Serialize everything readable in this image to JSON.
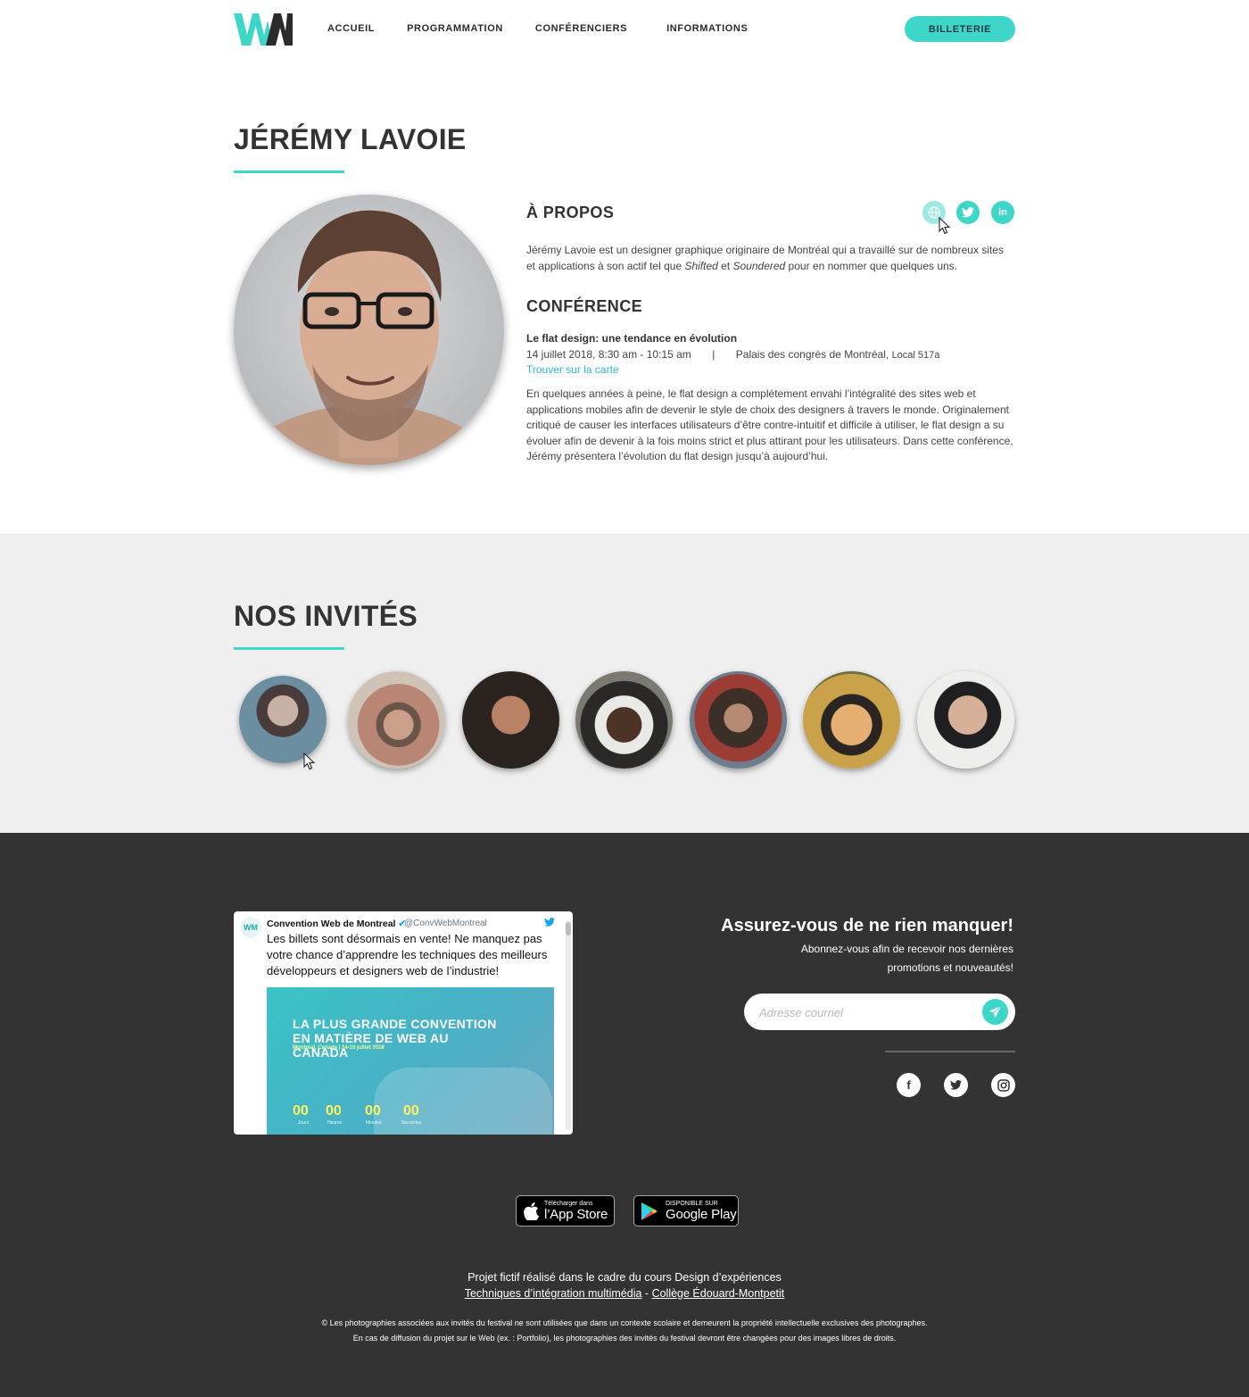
{
  "colors": {
    "accent": "#3dd6c9",
    "link": "#2ab7d4",
    "footer_bg": "#333333",
    "band_bg": "#efefef"
  },
  "header": {
    "logo_text": "WM",
    "nav": [
      "ACCUEIL",
      "PROGRAMMATION",
      "CONFÉRENCIERS",
      "INFORMATIONS"
    ],
    "ticket_label": "BILLETERIE"
  },
  "speaker": {
    "name": "JÉRÉMY LAVOIE",
    "about_heading": "À PROPOS",
    "social_icons": [
      "globe-icon",
      "twitter-icon",
      "linkedin-icon"
    ],
    "about_pre": "Jérémy Lavoie est un designer graphique originaire de Montréal qui a travaillé sur de nombreux sites et applications à son actif tel que ",
    "about_em1": "Shifted",
    "about_mid": " et ",
    "about_em2": "Soundered",
    "about_post": " pour en nommer que quelques uns.",
    "conference_heading": "CONFÉRENCE",
    "conference_title": "Le flat design: une tendance en évolution",
    "conference_datetime": "14 juillet 2018, 8:30 am - 10:15 am",
    "conference_separator": "|",
    "conference_venue": "Palais des congrès de Montréal,",
    "conference_room": "Local 517a",
    "map_link": "Trouver sur la carte",
    "conference_description": "En quelques années à peine, le flat design a complètement envahi l’intégralité des sites web et applications mobiles afin de devenir le style de choix des designers à travers le monde. Originalement critiqué de causer les interfaces utilisateurs d’être contre-intuitif et difficile à utiliser, le flat design a su évoluer afin de devenir à la fois moins strict et plus attirant pour les utilisateurs. Dans cette conférence, Jérémy présentera l’évolution du flat design jusqu’à aujourd’hui."
  },
  "guests": {
    "title": "NOS INVITÉS",
    "count": 7
  },
  "footer": {
    "tweet": {
      "account": "Convention Web de Montreal",
      "handle": "@ConvWebMontreal",
      "text": "Les billets sont désormais en vente! Ne manquez pas votre chance d’apprendre les techniques des meilleurs développeurs et designers web de l’industrie!",
      "media_headline": "LA PLUS GRANDE CONVENTION EN MATIÈRE DE WEB AU CANADA",
      "media_sub": "Montréal, Canada | 14-16 juillet 2018",
      "countdown": [
        {
          "value": "00",
          "label": "Jours"
        },
        {
          "value": "00",
          "label": "Heures"
        },
        {
          "value": "00",
          "label": "Minutes"
        },
        {
          "value": "00",
          "label": "Secondes"
        }
      ]
    },
    "newsletter_title": "Assurez-vous de ne rien manquer!",
    "newsletter_text": "Abonnez-vous afin de recevoir nos dernières promotions et nouveautés!",
    "email_placeholder": "Adresse courriel",
    "social_icons": [
      "facebook-icon",
      "twitter-icon",
      "instagram-icon"
    ],
    "app_store_small": "Télécharger dans",
    "app_store_big": "l’App Store",
    "google_play_small": "DISPONIBLE SUR",
    "google_play_big": "Google Play",
    "credit_line": "Projet fictif réalisé dans le cadre du cours Design d’expériences",
    "credit_link1": "Techniques d’intégration multimédia",
    "credit_dash": " - ",
    "credit_link2": "Collège Édouard-Montpetit",
    "legal_line1": "© Les photographies associées aux invités du festival ne sont utilisées que dans un contexte scolaire et demeurent la propriété intellectuelle exclusives des photographes.",
    "legal_line2": "En cas de diffusion du projet sur le Web (ex. : Portfolio), les photographies des invités du festival devront être changées pour des images libres de droits."
  }
}
